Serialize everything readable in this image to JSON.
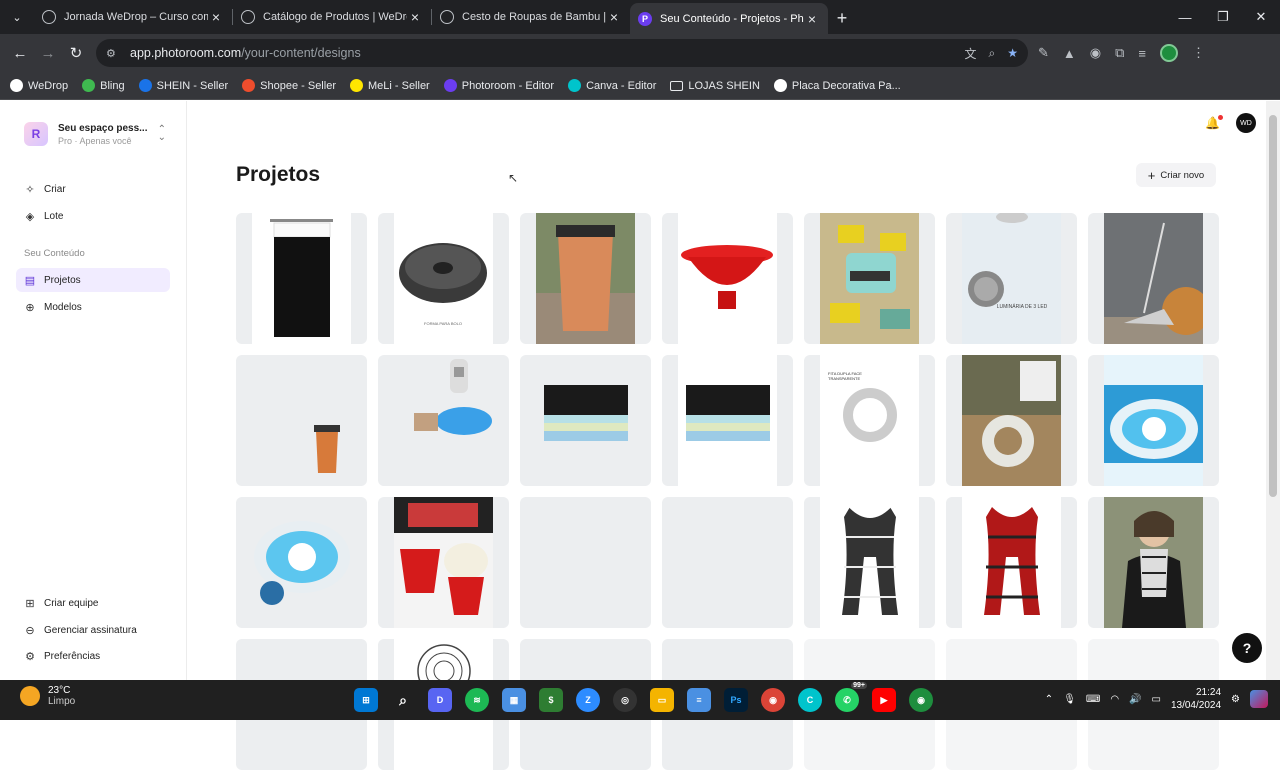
{
  "browser": {
    "tabs": [
      {
        "title": "Jornada WeDrop – Curso comp",
        "active": false
      },
      {
        "title": "Catálogo de Produtos | WeDrop",
        "active": false
      },
      {
        "title": "Cesto de Roupas de Bambu | W",
        "active": false
      },
      {
        "title": "Seu Conteúdo - Projetos - Phot",
        "active": true
      }
    ],
    "url_host": "app.photoroom.com",
    "url_path": "/your-content/designs",
    "bookmarks": [
      {
        "label": "WeDrop",
        "color": "#ffffff"
      },
      {
        "label": "Bling",
        "color": "#3fb950"
      },
      {
        "label": "SHEIN - Seller",
        "color": "#1a73e8"
      },
      {
        "label": "Shopee - Seller",
        "color": "#ee4d2d"
      },
      {
        "label": "MeLi - Seller",
        "color": "#ffe600"
      },
      {
        "label": "Photoroom - Editor",
        "color": "#6b3df0"
      },
      {
        "label": "Canva - Editor",
        "color": "#00c4cc"
      },
      {
        "label": "LOJAS SHEIN",
        "color": "folder"
      },
      {
        "label": "Placa Decorativa Pa...",
        "color": "#ffffff"
      }
    ]
  },
  "sidebar": {
    "workspace_name": "Seu espaço pess...",
    "workspace_sub": "Pro · Apenas você",
    "items_top": [
      {
        "label": "Criar",
        "icon": "sparkle-icon"
      },
      {
        "label": "Lote",
        "icon": "stack-icon"
      }
    ],
    "section_label": "Seu Conteúdo",
    "items_content": [
      {
        "label": "Projetos",
        "icon": "file-icon",
        "active": true
      },
      {
        "label": "Modelos",
        "icon": "template-icon",
        "active": false
      }
    ],
    "items_bottom": [
      {
        "label": "Criar equipe",
        "icon": "team-icon"
      },
      {
        "label": "Gerenciar assinatura",
        "icon": "card-icon"
      },
      {
        "label": "Preferências",
        "icon": "gear-icon"
      }
    ]
  },
  "main": {
    "title": "Projetos",
    "create_label": "Criar novo"
  },
  "projects": [
    {
      "name": "shower-curtain",
      "kind": "curtain",
      "bg": "#ffffff"
    },
    {
      "name": "cake-pan",
      "kind": "pan",
      "bg": "#ffffff",
      "caption": "FORMA PARA BOLO"
    },
    {
      "name": "copper-trash-bin",
      "kind": "bin",
      "bg": "#6c7a5c"
    },
    {
      "name": "red-popcorn-bowl",
      "kind": "redbowl",
      "bg": "#ffffff"
    },
    {
      "name": "soap-dispenser-sponge",
      "kind": "sponge",
      "bg": "#d8c59a"
    },
    {
      "name": "led-luminaria",
      "kind": "led",
      "bg": "#e8eef4",
      "caption": "LUMINÁRIA DE 3 LED"
    },
    {
      "name": "broom-mop",
      "kind": "broom",
      "bg": "#7a7d80"
    },
    {
      "name": "small-bin",
      "kind": "smallbin",
      "bg": "#eceef0"
    },
    {
      "name": "water-dispenser",
      "kind": "water",
      "bg": "#eceef0"
    },
    {
      "name": "black-mat-stack",
      "kind": "mats",
      "bg": "#eceef0"
    },
    {
      "name": "black-mat-stack-2",
      "kind": "mats",
      "bg": "#ffffff"
    },
    {
      "name": "nano-tape",
      "kind": "tape",
      "bg": "#ffffff",
      "caption": "FITA DUPLA FACE TRANSPARENTE"
    },
    {
      "name": "nano-tape-2",
      "kind": "tape2",
      "bg": "#a0845e"
    },
    {
      "name": "folding-washer",
      "kind": "washer",
      "bg": "#3aa9e0"
    },
    {
      "name": "folding-washer-2",
      "kind": "washer2",
      "bg": "#eceef0"
    },
    {
      "name": "popcorn-bowl-red",
      "kind": "popcorn",
      "bg": "#c21a1a"
    },
    {
      "name": "empty-1",
      "kind": "empty",
      "bg": "#eceef0"
    },
    {
      "name": "empty-2",
      "kind": "empty",
      "bg": "#eceef0"
    },
    {
      "name": "plaid-scarf-bw",
      "kind": "scarfbw",
      "bg": "#ffffff"
    },
    {
      "name": "plaid-scarf-red",
      "kind": "scarfred",
      "bg": "#ffffff"
    },
    {
      "name": "scarf-model",
      "kind": "model",
      "bg": "#8a8f7a"
    },
    {
      "name": "empty-3",
      "kind": "empty",
      "bg": "#eceef0"
    },
    {
      "name": "fan-grill",
      "kind": "fan",
      "bg": "#ffffff"
    },
    {
      "name": "empty-4",
      "kind": "empty",
      "bg": "#eceef0"
    },
    {
      "name": "empty-5",
      "kind": "empty",
      "bg": "#eceef0"
    },
    {
      "name": "empty-6",
      "kind": "empty",
      "bg": "#f4f5f6"
    },
    {
      "name": "empty-7",
      "kind": "empty",
      "bg": "#f4f5f6"
    },
    {
      "name": "empty-8",
      "kind": "empty",
      "bg": "#f4f5f6"
    }
  ],
  "taskbar": {
    "temperature": "23°C",
    "weather": "Limpo",
    "time": "21:24",
    "date": "13/04/2024",
    "badge": "99+"
  }
}
